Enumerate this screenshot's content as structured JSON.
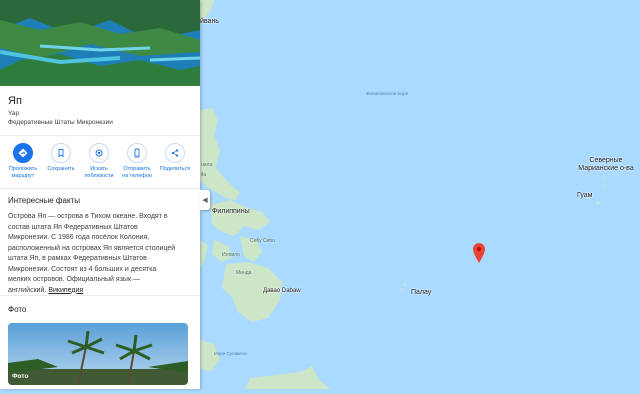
{
  "place": {
    "name": "Яп",
    "native_name": "Yap",
    "region": "Федеративные Штаты Микронезии"
  },
  "actions": [
    {
      "label_line1": "Проложить",
      "label_line2": "маршрут",
      "icon": "directions-icon"
    },
    {
      "label_line1": "Сохранить",
      "label_line2": "",
      "icon": "bookmark-icon"
    },
    {
      "label_line1": "Искать",
      "label_line2": "поблизости",
      "icon": "nearby-icon"
    },
    {
      "label_line1": "Отправить",
      "label_line2": "на телефон",
      "icon": "phone-icon"
    },
    {
      "label_line1": "Поделиться",
      "label_line2": "",
      "icon": "share-icon"
    }
  ],
  "facts": {
    "title": "Интересные факты",
    "text": "Острова Яп — острова в Тихом океане. Входят в состав штата Яп Федеративных Штатов Микронезии. С 1986 года посёлок Колония, расположенный на островах Яп является столицей штата Яп, в рамках Федеративных Штатов Микронезии. Состоят из 4 больших и десятка мелких островов. Официальный язык — английский.",
    "link": "Википедия"
  },
  "photos": {
    "title": "Фото",
    "label": "Фото"
  },
  "map": {
    "labels": {
      "taiwan": "йвань",
      "philippine_sea": "Филиппинское море",
      "philippines": "Филиппины",
      "palau": "Палау",
      "guam": "Гуам",
      "nmi": "Северные Марианские о-ва",
      "davao": "Давао Dabaw",
      "celebes": "Море Сулавеси",
      "manila": "нила",
      "manila2": "ila",
      "cebu": "Себу Cebu",
      "iloilo": "Илоило",
      "mindanao": "Минда"
    },
    "marker": "location-pin-icon",
    "colors": {
      "water": "#aadaff",
      "land": "#cde6c8",
      "accent": "#1a73e8",
      "pin": "#ea4335"
    }
  }
}
